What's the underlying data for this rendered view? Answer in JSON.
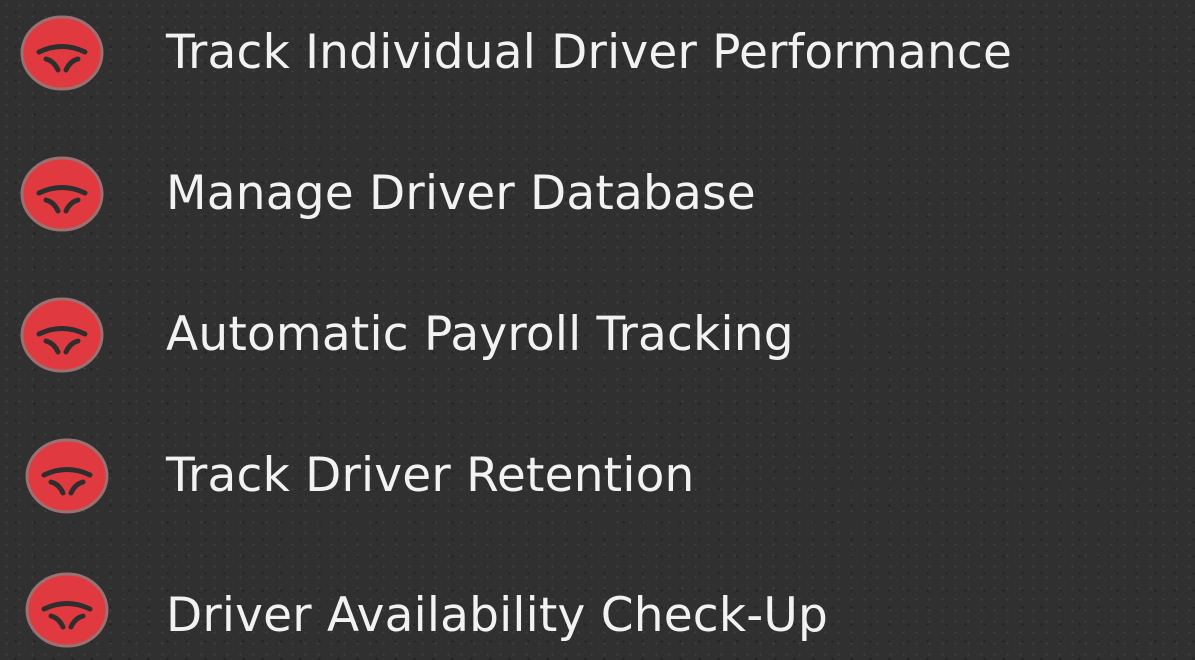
{
  "features": {
    "icon": "steering-wheel-icon",
    "icon_color": "#e03a40",
    "icon_border_color": "#9a7070",
    "icon_glyph_color": "#2e2e2e",
    "items": [
      {
        "label": "Track Individual Driver Performance"
      },
      {
        "label": "Manage Driver Database"
      },
      {
        "label": "Automatic Payroll Tracking"
      },
      {
        "label": "Track Driver Retention"
      },
      {
        "label": "Driver Availability Check-Up"
      }
    ]
  }
}
